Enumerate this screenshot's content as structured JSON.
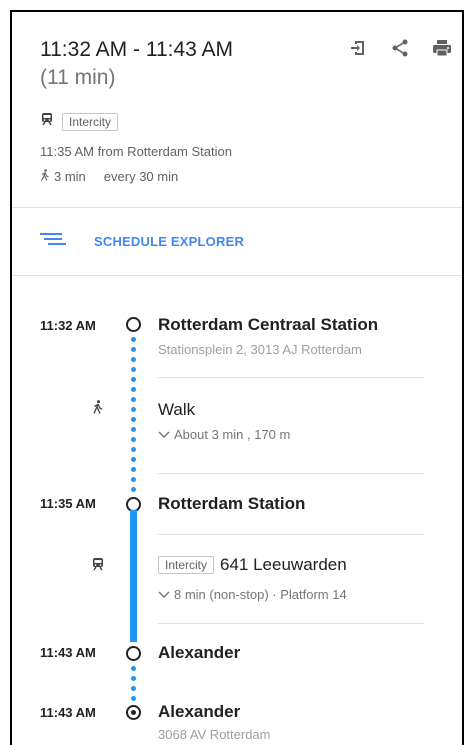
{
  "summary": {
    "time_range": "11:32 AM - 11:43 AM",
    "duration": "(11 min)",
    "mode_badge": "Intercity",
    "departure": "11:35 AM from Rotterdam Station",
    "walk_time": "3 min",
    "frequency": "every 30 min",
    "actions": [
      "send-to-device-icon",
      "share-icon",
      "print-icon"
    ]
  },
  "schedule_explorer": {
    "label": "SCHEDULE EXPLORER"
  },
  "timeline": {
    "start": {
      "time": "11:32 AM",
      "name": "Rotterdam Centraal Station",
      "address": "Stationsplein 2, 3013 AJ Rotterdam"
    },
    "walk": {
      "label": "Walk",
      "detail": "About 3 min , 170 m"
    },
    "board": {
      "time": "11:35 AM",
      "name": "Rotterdam Station"
    },
    "ride": {
      "badge": "Intercity",
      "line": "641 Leeuwarden",
      "detail": "8 min (non-stop) · Platform 14"
    },
    "alight": {
      "time": "11:43 AM",
      "name": "Alexander"
    },
    "end": {
      "time": "11:43 AM",
      "name": "Alexander",
      "address": "3068 AV Rotterdam"
    }
  },
  "colors": {
    "accent": "#4285f4",
    "route": "#2196f3"
  }
}
